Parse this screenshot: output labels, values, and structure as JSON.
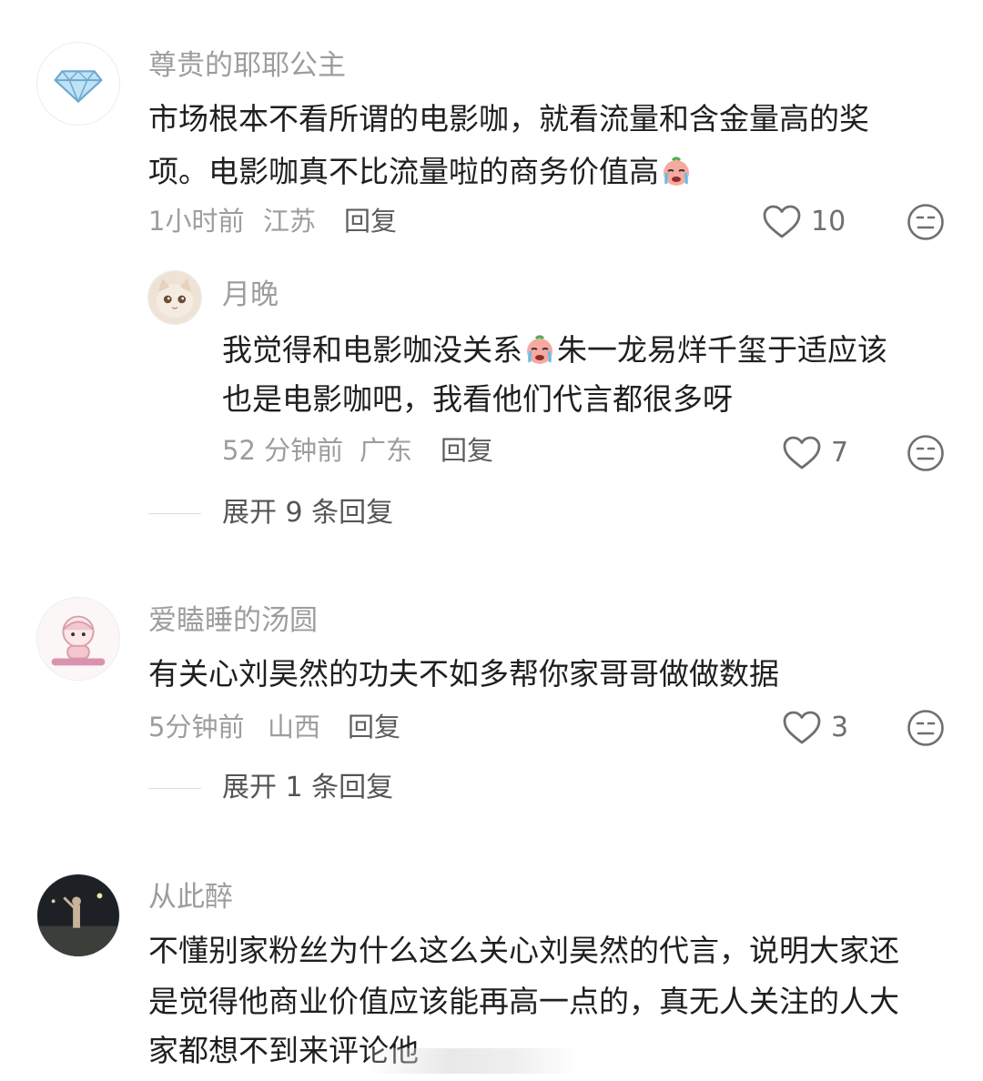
{
  "comments": [
    {
      "author": "尊贵的耶耶公主",
      "avatar_icon": "diamond-icon",
      "text_line1": "市场根本不看所谓的电影咖，就看流量和含金量高的奖",
      "text_line2": "项。电影咖真不比流量啦的商务价值高",
      "emoji_icon": "crying-face-emoji",
      "time": "1小时前",
      "location": "江苏",
      "reply_label": "回复",
      "likes": "10",
      "reply": {
        "author": "月晚",
        "avatar_icon": "cat-avatar",
        "text_line1_a": "我觉得和电影咖没关系",
        "text_line1_b": "朱一龙易烊千玺于适应该",
        "text_line2": "也是电影咖吧，我看他们代言都很多呀",
        "time": "52 分钟前",
        "location": "广东",
        "reply_label": "回复",
        "likes": "7"
      },
      "expand_label": "展开 9 条回复"
    },
    {
      "author": "爱瞌睡的汤圆",
      "avatar_icon": "cartoon-girl-avatar",
      "text_line1": "有关心刘昊然的功夫不如多帮你家哥哥做做数据",
      "time": "5分钟前",
      "location": "山西",
      "reply_label": "回复",
      "likes": "3",
      "expand_label": "展开 1 条回复"
    },
    {
      "author": "从此醉",
      "avatar_icon": "night-photo-avatar",
      "text_line1": "不懂别家粉丝为什么这么关心刘昊然的代言，说明大家还",
      "text_line2": "是觉得他商业价值应该能再高一点的，真无人关注的人大",
      "text_line3": "家都想不到来评论他"
    }
  ],
  "colors": {
    "name_gray": "#9d9d9d",
    "text_dark": "#1f1f1f",
    "icon_gray": "#6f6f6f"
  }
}
